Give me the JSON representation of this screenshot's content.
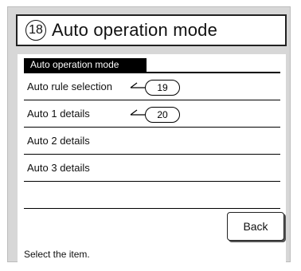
{
  "title": {
    "number": "18",
    "text": "Auto operation mode"
  },
  "screen": {
    "header": "Auto operation mode",
    "items": [
      {
        "label": "Auto rule selection",
        "callout": "19"
      },
      {
        "label": "Auto 1 details",
        "callout": "20"
      },
      {
        "label": "Auto 2 details"
      },
      {
        "label": "Auto 3 details"
      }
    ],
    "back_label": "Back",
    "status": "Select the item."
  }
}
